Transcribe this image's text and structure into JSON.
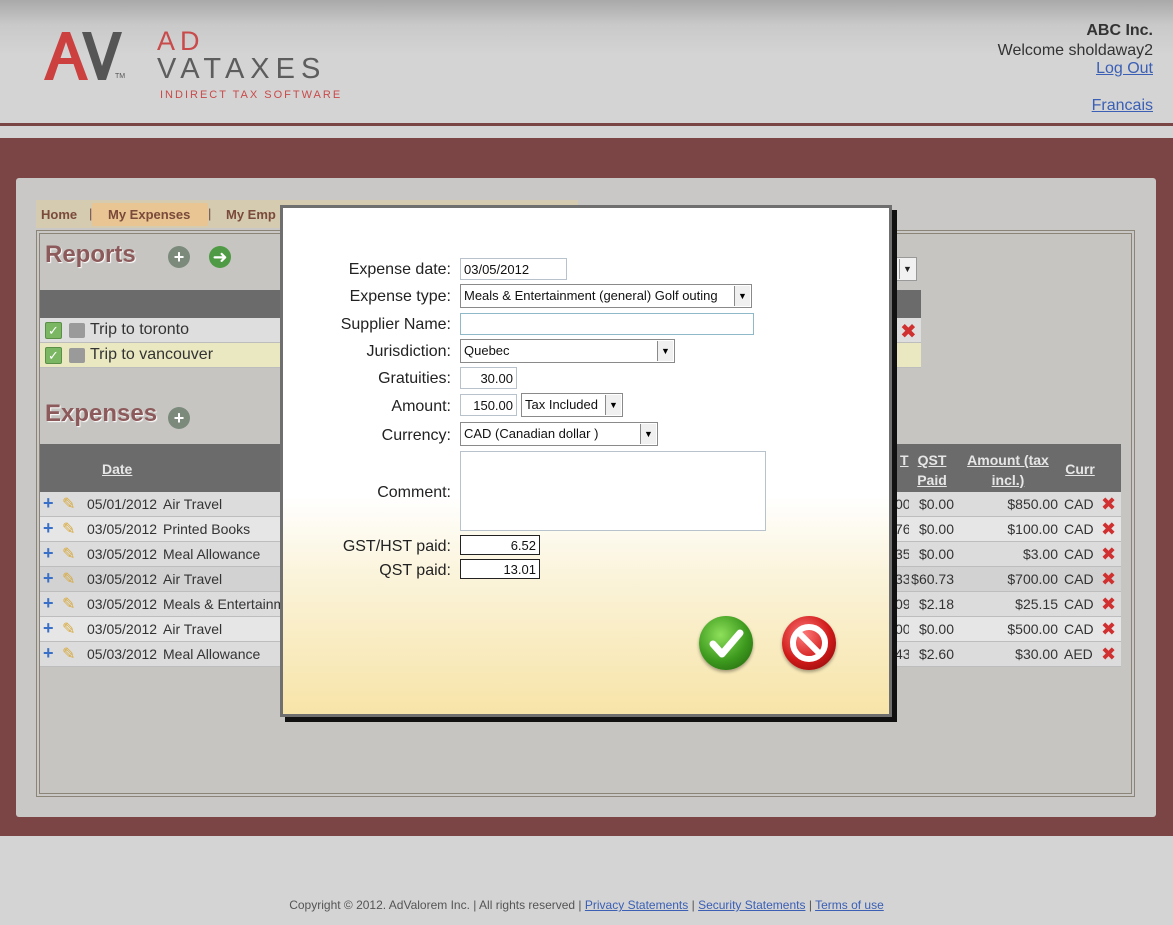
{
  "header": {
    "brand_top": "AD",
    "brand_main": "VATAXES",
    "brand_sub": "INDIRECT TAX SOFTWARE",
    "logo_tm": "TM",
    "company": "ABC Inc.",
    "welcome": "Welcome sholdaway2",
    "logout": "Log Out",
    "language": "Francais"
  },
  "nav": {
    "home": "Home",
    "my_expenses": "My Expenses",
    "my_employees": "My Emp",
    "sep": "|"
  },
  "reports": {
    "title": "Reports",
    "rows": [
      "Trip to toronto",
      "Trip to vancouver"
    ]
  },
  "expenses": {
    "title": "Expenses",
    "headers": {
      "date": "Date",
      "gst_partial": "T",
      "qst_paid": "QST Paid",
      "amount": "Amount (tax incl.)",
      "currency": "Curr"
    },
    "rows": [
      {
        "date": "05/01/2012",
        "type": "Air Travel",
        "gst": "00",
        "qst": "$0.00",
        "amount": "$850.00",
        "curr": "CAD"
      },
      {
        "date": "03/05/2012",
        "type": "Printed Books",
        "gst": "76",
        "qst": "$0.00",
        "amount": "$100.00",
        "curr": "CAD"
      },
      {
        "date": "03/05/2012",
        "type": "Meal Allowance",
        "gst": "35",
        "qst": "$0.00",
        "amount": "$3.00",
        "curr": "CAD"
      },
      {
        "date": "03/05/2012",
        "type": "Air Travel",
        "gst": "33",
        "qst": "$60.73",
        "amount": "$700.00",
        "curr": "CAD"
      },
      {
        "date": "03/05/2012",
        "type": "Meals & Entertainm",
        "gst": "09",
        "qst": "$2.18",
        "amount": "$25.15",
        "curr": "CAD"
      },
      {
        "date": "03/05/2012",
        "type": "Air Travel",
        "gst": "00",
        "qst": "$0.00",
        "amount": "$500.00",
        "curr": "CAD"
      },
      {
        "date": "05/03/2012",
        "type": "Meal Allowance",
        "gst": "43",
        "qst": "$2.60",
        "amount": "$30.00",
        "curr": "AED"
      }
    ]
  },
  "modal": {
    "labels": {
      "expense_date": "Expense date:",
      "expense_type": "Expense type:",
      "supplier_name": "Supplier Name:",
      "jurisdiction": "Jurisdiction:",
      "gratuities": "Gratuities:",
      "amount": "Amount:",
      "currency": "Currency:",
      "comment": "Comment:",
      "gst_hst_paid": "GST/HST paid:",
      "qst_paid": "QST paid:"
    },
    "values": {
      "expense_date": "03/05/2012",
      "expense_type": "Meals & Entertainment (general) Golf outing",
      "supplier_name": "",
      "jurisdiction": "Quebec",
      "gratuities": "30.00",
      "amount": "150.00",
      "tax_mode": "Tax Included",
      "currency": "CAD (Canadian dollar )",
      "comment": "",
      "gst_hst_paid": "6.52",
      "qst_paid": "13.01"
    }
  },
  "footer": {
    "copyright": "Copyright © 2012. AdValorem Inc. | All rights reserved |",
    "privacy": "Privacy Statements",
    "security": "Security Statements",
    "terms": "Terms of use",
    "sep": "|"
  }
}
